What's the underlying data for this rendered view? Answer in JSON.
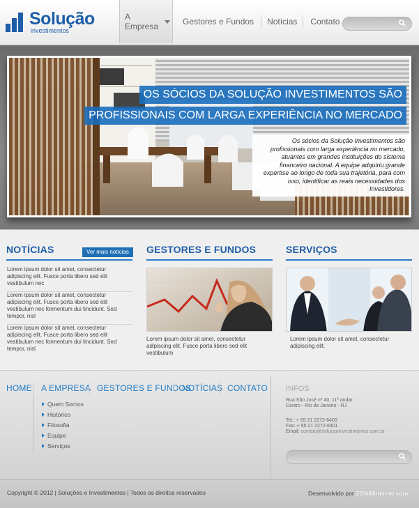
{
  "header": {
    "logo_name": "Solução",
    "logo_sub": "investimentos",
    "nav": [
      {
        "label": "A Empresa",
        "active": true
      },
      {
        "label": "Gestores e Fundos"
      },
      {
        "label": "Notícias"
      },
      {
        "label": "Contato"
      }
    ],
    "search_placeholder": ""
  },
  "hero": {
    "title_line1": "OS SÓCIOS DA SOLUÇÃO INVESTIMENTOS SÃO",
    "title_line2": "PROFISSIONAIS COM LARGA EXPERIÊNCIA NO MERCADO",
    "text": "Os sócios da Solução Investimentos são profissionais com larga experiência no mercado, atuantes em grandes instituições do sistema financeiro nacional. A equipe adquiriu grande expertise ao longo de toda sua trajetória, para com  isso, identificar as reais necessidades dos Investidores."
  },
  "news": {
    "title": "NOTÍCIAS",
    "more": "Ver mais notícias",
    "items": [
      "Lorem ipsum dolor sit amet, consectetur adipiscing elit. Fusce porta libero sed elit vestibulum nec",
      "Lorem ipsum dolor sit amet, consectetur adipiscing elit. Fusce porta libero sed elit vestibulum nec formentum dui tincidunt. Sed tempor, nisl",
      "Lorem ipsum dolor sit amet, consectetur adipiscing elit. Fusce porta libero sed elit vestibulum nec formentum dui tincidunt. Sed tempor, nisl"
    ]
  },
  "funds": {
    "title": "GESTORES E FUNDOS",
    "text": "Lorem ipsum dolor sit amet, consectetur adipiscing elit. Fusce porta libero sed elit vestibulum"
  },
  "services": {
    "title": "SERVIÇOS",
    "text": "Lorem ipsum dolor sit amet, consectetur adipiscing elit."
  },
  "footer": {
    "nav": [
      "HOME",
      "A EMPRESA",
      "GESTORES E FUNDOS",
      "NOTÍCIAS",
      "CONTATO"
    ],
    "submenu": [
      "Quem Somos",
      "Histórico",
      "Filosofia",
      "Equipe",
      "Serviços"
    ],
    "info_title": "INFOS",
    "address1": "Rua São José nº 40, 11º andar",
    "address2": "Centro - Rio de Janeiro - RJ",
    "tel": "Tel.: + 55  21  2272-6400",
    "fax": "Fax: + 55  21  2272-6401",
    "email_label": "Email:",
    "email": "contato@solucaoinvestimentos.com.br",
    "copyright": "Copyright © 2012 | Soluções e Investimentos |  Todos os direitos reservados",
    "dev_label": "Desenvolvido por",
    "dev_name": "ZONAInternet.com"
  },
  "colors": {
    "brand": "#1f5ea8",
    "accent": "#2a7bc6"
  }
}
